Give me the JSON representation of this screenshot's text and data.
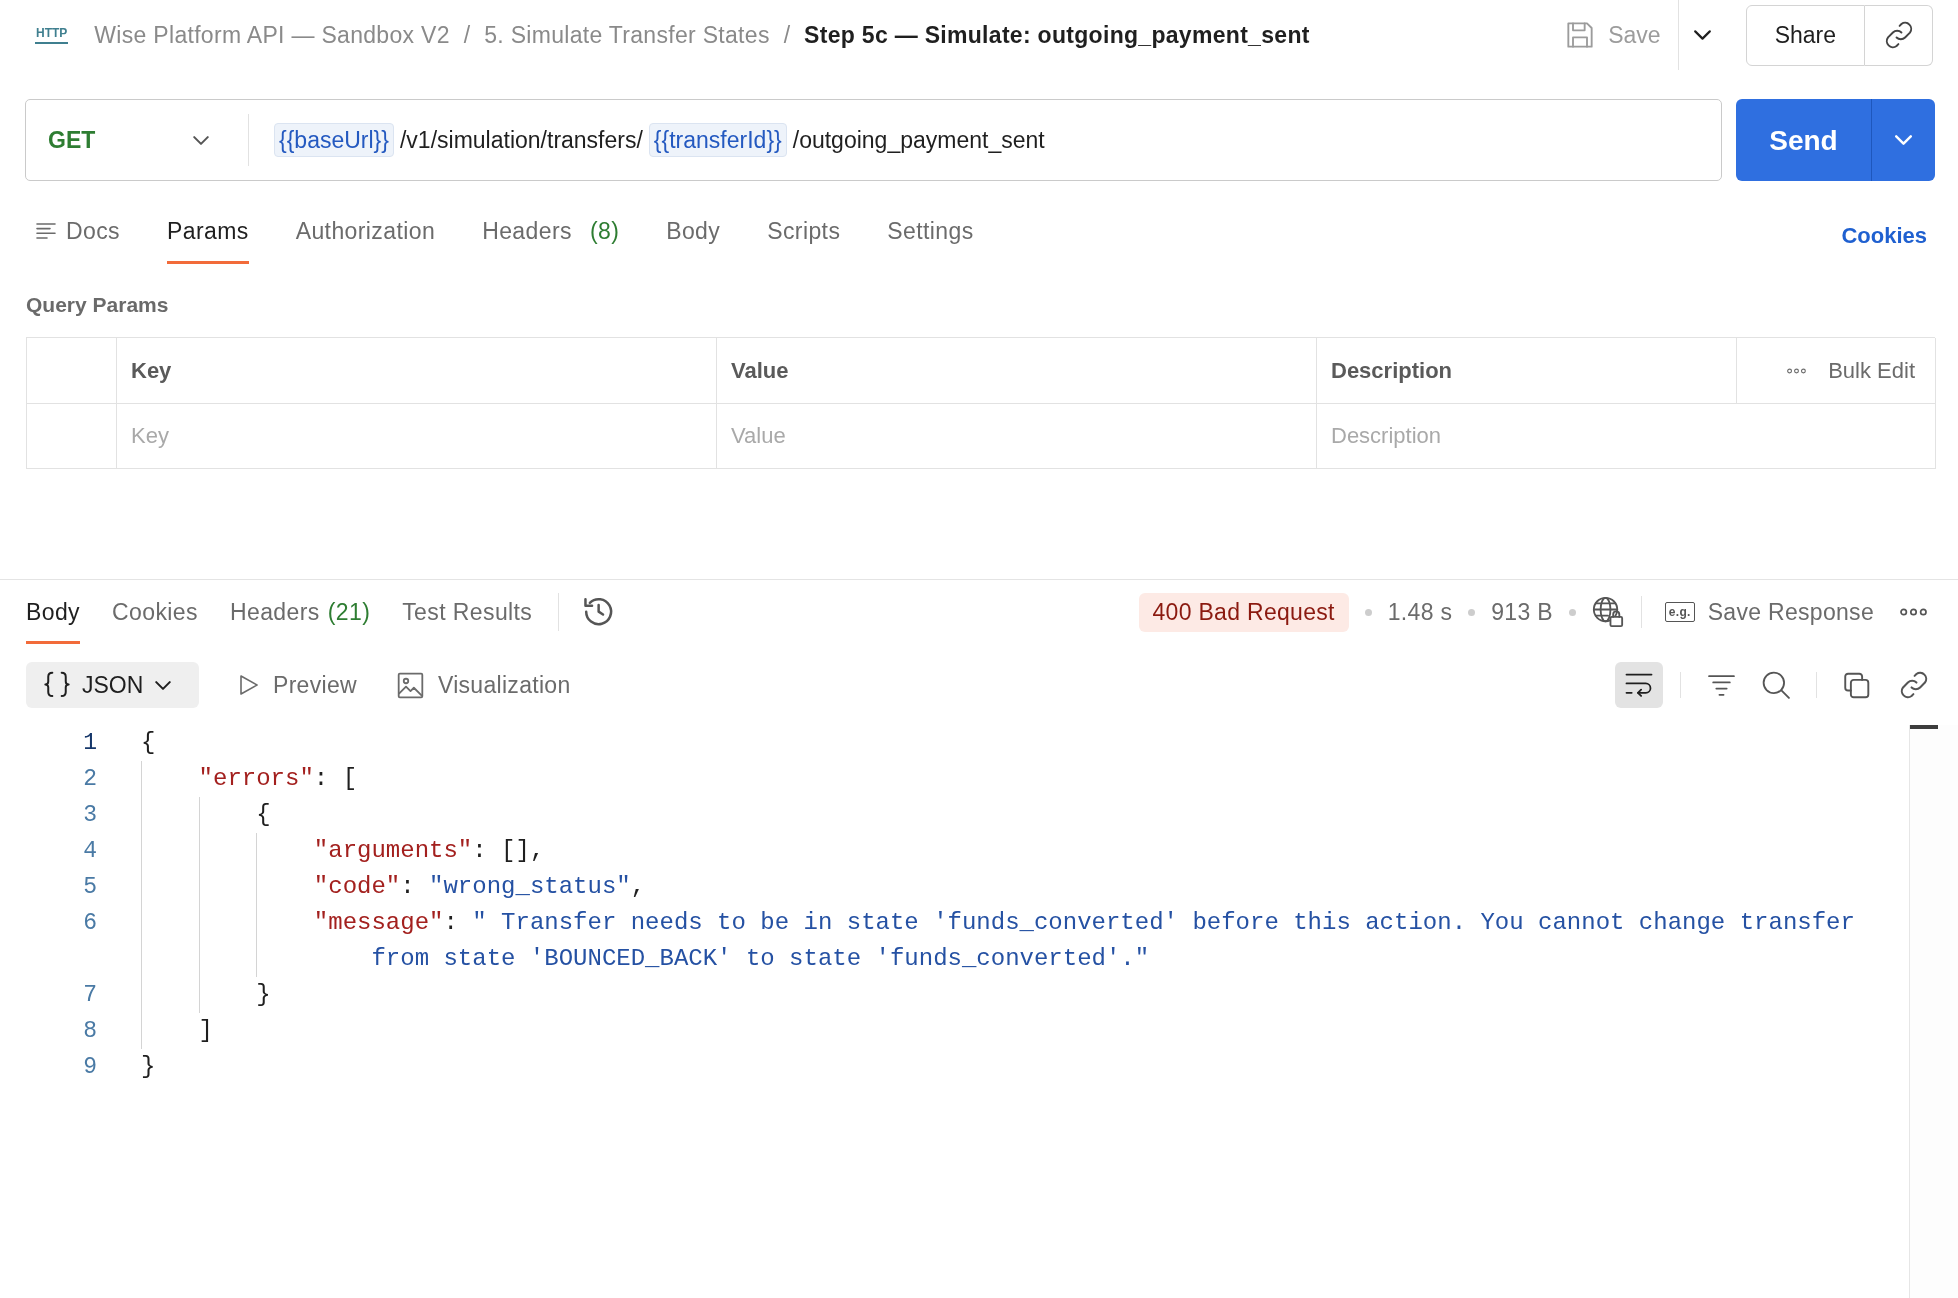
{
  "header": {
    "request_type": "HTTP",
    "breadcrumb": [
      {
        "kind": "link",
        "label": "Wise Platform API — Sandbox V2"
      },
      {
        "kind": "separator",
        "label": "/"
      },
      {
        "kind": "link",
        "label": "5. Simulate Transfer States"
      },
      {
        "kind": "separator",
        "label": "/"
      },
      {
        "kind": "current",
        "label": "Step 5c — Simulate: outgoing_payment_sent"
      }
    ],
    "save": {
      "label": "Save",
      "disabled": true
    },
    "share": {
      "label": "Share"
    }
  },
  "request": {
    "method": "GET",
    "url": [
      {
        "kind": "variable",
        "text": "{{baseUrl}}"
      },
      {
        "kind": "path",
        "text": "/v1/simulation/transfers/"
      },
      {
        "kind": "variable",
        "text": "{{transferId}}"
      },
      {
        "kind": "path",
        "text": "/outgoing_payment_sent"
      }
    ],
    "send": {
      "label": "Send"
    }
  },
  "request_tabs": [
    {
      "kind": "docs",
      "label": "Docs",
      "selected": false
    },
    {
      "kind": "plain",
      "label": "Params",
      "selected": true
    },
    {
      "kind": "plain",
      "label": "Authorization",
      "selected": false
    },
    {
      "kind": "plain",
      "label": "Headers",
      "count": "(8)",
      "selected": false
    },
    {
      "kind": "plain",
      "label": "Body",
      "selected": false
    },
    {
      "kind": "plain",
      "label": "Scripts",
      "selected": false
    },
    {
      "kind": "plain",
      "label": "Settings",
      "selected": false
    }
  ],
  "cookies_link": {
    "label": "Cookies"
  },
  "query_params": {
    "title": "Query Params",
    "columns": [
      "Key",
      "Value",
      "Description"
    ],
    "bulk_edit": {
      "label": "Bulk Edit"
    },
    "new_row": [
      {
        "placeholder": "Key"
      },
      {
        "placeholder": "Value"
      },
      {
        "placeholder": "Description"
      }
    ]
  },
  "response": {
    "tabs": [
      {
        "label": "Body",
        "selected": true
      },
      {
        "label": "Cookies",
        "selected": false
      },
      {
        "label": "Headers",
        "count": "(21)",
        "selected": false
      },
      {
        "label": "Test Results",
        "selected": false
      }
    ],
    "status": {
      "kind": "error",
      "label": "400 Bad Request"
    },
    "time": "1.48 s",
    "size": "913 B",
    "save_response": {
      "example_tag": "e.g.",
      "label": "Save Response"
    },
    "format": {
      "label": "JSON"
    },
    "views": [
      {
        "kind": "preview",
        "label": "Preview"
      },
      {
        "kind": "visualization",
        "label": "Visualization"
      }
    ],
    "wrap_lines": {
      "on": true
    },
    "body": {
      "lines": [
        {
          "number": "1",
          "active": true,
          "tokens": [
            {
              "kind": "punct",
              "text": "{"
            }
          ],
          "children": [
            {
              "number": "2",
              "active": false,
              "tokens": [
                {
                  "kind": "key",
                  "text": "\"errors\""
                },
                {
                  "kind": "punct",
                  "text": ": ["
                }
              ],
              "children": [
                {
                  "number": "3",
                  "active": false,
                  "tokens": [
                    {
                      "kind": "punct",
                      "text": "{"
                    }
                  ],
                  "children": [
                    {
                      "number": "4",
                      "active": false,
                      "tokens": [
                        {
                          "kind": "key",
                          "text": "\"arguments\""
                        },
                        {
                          "kind": "punct",
                          "text": ": [],"
                        }
                      ]
                    },
                    {
                      "number": "5",
                      "active": false,
                      "tokens": [
                        {
                          "kind": "key",
                          "text": "\"code\""
                        },
                        {
                          "kind": "punct",
                          "text": ": "
                        },
                        {
                          "kind": "string",
                          "text": "\"wrong_status\""
                        },
                        {
                          "kind": "punct",
                          "text": ","
                        }
                      ]
                    },
                    {
                      "number": "6",
                      "active": false,
                      "tokens": [
                        {
                          "kind": "key",
                          "text": "\"message\""
                        },
                        {
                          "kind": "punct",
                          "text": ": "
                        },
                        {
                          "kind": "string",
                          "text": "\" Transfer needs to be in state 'funds_converted' before this action. You cannot change transfer from state 'BOUNCED_BACK' to state 'funds_converted'.\""
                        }
                      ]
                    }
                  ]
                },
                {
                  "number": "7",
                  "active": false,
                  "tokens": [
                    {
                      "kind": "punct",
                      "text": "}"
                    }
                  ]
                }
              ]
            },
            {
              "number": "8",
              "active": false,
              "tokens": [
                {
                  "kind": "punct",
                  "text": "]"
                }
              ]
            }
          ]
        },
        {
          "number": "9",
          "active": false,
          "tokens": [
            {
              "kind": "punct",
              "text": "}"
            }
          ]
        }
      ]
    }
  }
}
